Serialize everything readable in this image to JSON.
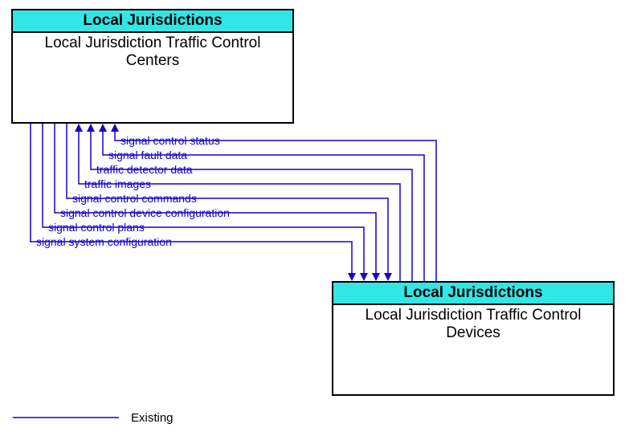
{
  "entities": {
    "top": {
      "header": "Local Jurisdictions",
      "body": "Local Jurisdiction Traffic Control Centers"
    },
    "bottom": {
      "header": "Local Jurisdictions",
      "body": "Local Jurisdiction Traffic Control Devices"
    }
  },
  "flows": {
    "to_centers": [
      "signal control status",
      "signal fault data",
      "traffic detector data",
      "traffic images"
    ],
    "to_devices": [
      "signal control commands",
      "signal control device configuration",
      "signal control plans",
      "signal system configuration"
    ]
  },
  "legend": {
    "existing": "Existing"
  },
  "colors": {
    "flow": "#1700c9",
    "header_bg": "#33e6e6"
  }
}
